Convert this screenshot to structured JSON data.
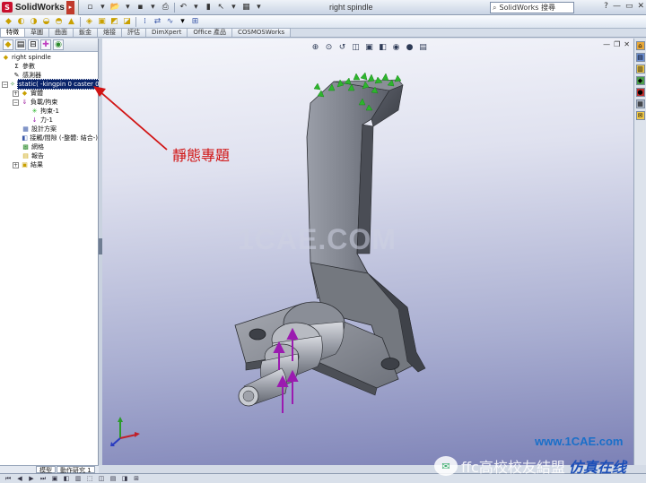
{
  "app": {
    "brand": "SolidWorks",
    "document_title": "right spindle"
  },
  "search": {
    "value": "SolidWorks 搜尋"
  },
  "window_controls": [
    "?",
    "—",
    "▭",
    "✕"
  ],
  "command_tabs": [
    "特徵",
    "草圖",
    "曲面",
    "鈑金",
    "熔接",
    "評估",
    "DimXpert",
    "Office 產品",
    "COSMOSWorks"
  ],
  "tree": {
    "root": "right spindle",
    "items": [
      {
        "label": "參數",
        "icon": "parameters-icon"
      },
      {
        "label": "感測器",
        "icon": "sensors-icon"
      },
      {
        "label": "static( -kingpin 0 caster 0-)",
        "icon": "study-icon",
        "selected": true
      },
      {
        "label": "實體",
        "icon": "solid-icon"
      },
      {
        "label": "負載/拘束",
        "icon": "loads-icon"
      },
      {
        "label": "拘束-1",
        "icon": "fixture-icon"
      },
      {
        "label": "力-1",
        "icon": "force-icon"
      },
      {
        "label": "設計方案",
        "icon": "design-icon"
      },
      {
        "label": "接觸/間隙 (-整體: 結合-)",
        "icon": "contact-icon"
      },
      {
        "label": "網格",
        "icon": "mesh-icon"
      },
      {
        "label": "報告",
        "icon": "report-icon"
      },
      {
        "label": "結果",
        "icon": "results-icon"
      }
    ]
  },
  "bottom_tabs": [
    "模型",
    "動作研究 1"
  ],
  "annotation": {
    "text": "靜態專題",
    "color": "#d11414"
  },
  "watermarks": {
    "center": "1CAE.COM",
    "footer_cn": "ffc高校校友結盟",
    "footer_blue": "仿真在线",
    "site": "www.1CAE.com"
  },
  "colors": {
    "annotation": "#d11414",
    "selection": "#0a246a",
    "fixture": "#2db52d",
    "force": "#9b1bb0"
  }
}
